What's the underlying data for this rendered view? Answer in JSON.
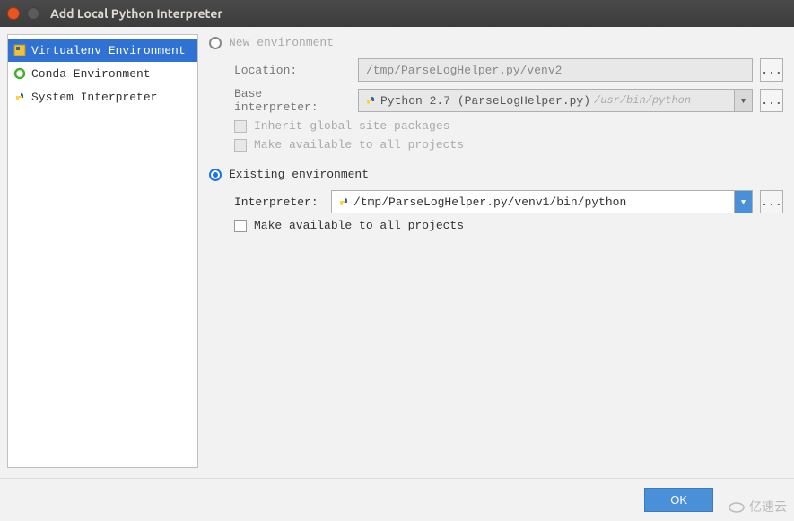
{
  "window": {
    "title": "Add Local Python Interpreter"
  },
  "sidebar": {
    "items": [
      {
        "label": "Virtualenv Environment",
        "icon": "venv",
        "selected": true
      },
      {
        "label": "Conda Environment",
        "icon": "conda",
        "selected": false
      },
      {
        "label": "System Interpreter",
        "icon": "python",
        "selected": false
      }
    ]
  },
  "main": {
    "new_env": {
      "radio_label": "New environment",
      "checked": false,
      "location_label": "Location:",
      "location_value": "/tmp/ParseLogHelper.py/venv2",
      "base_label": "Base interpreter:",
      "base_value": "Python 2.7 (ParseLogHelper.py)",
      "base_hint": "/usr/bin/python",
      "inherit_label": "Inherit global site-packages",
      "available_all_label": "Make available to all projects"
    },
    "existing_env": {
      "radio_label": "Existing environment",
      "checked": true,
      "interpreter_label": "Interpreter:",
      "interpreter_value": "/tmp/ParseLogHelper.py/venv1/bin/python",
      "available_all_label": "Make available to all projects"
    }
  },
  "footer": {
    "ok_label": "OK"
  },
  "watermark": "亿速云",
  "browse": "..."
}
